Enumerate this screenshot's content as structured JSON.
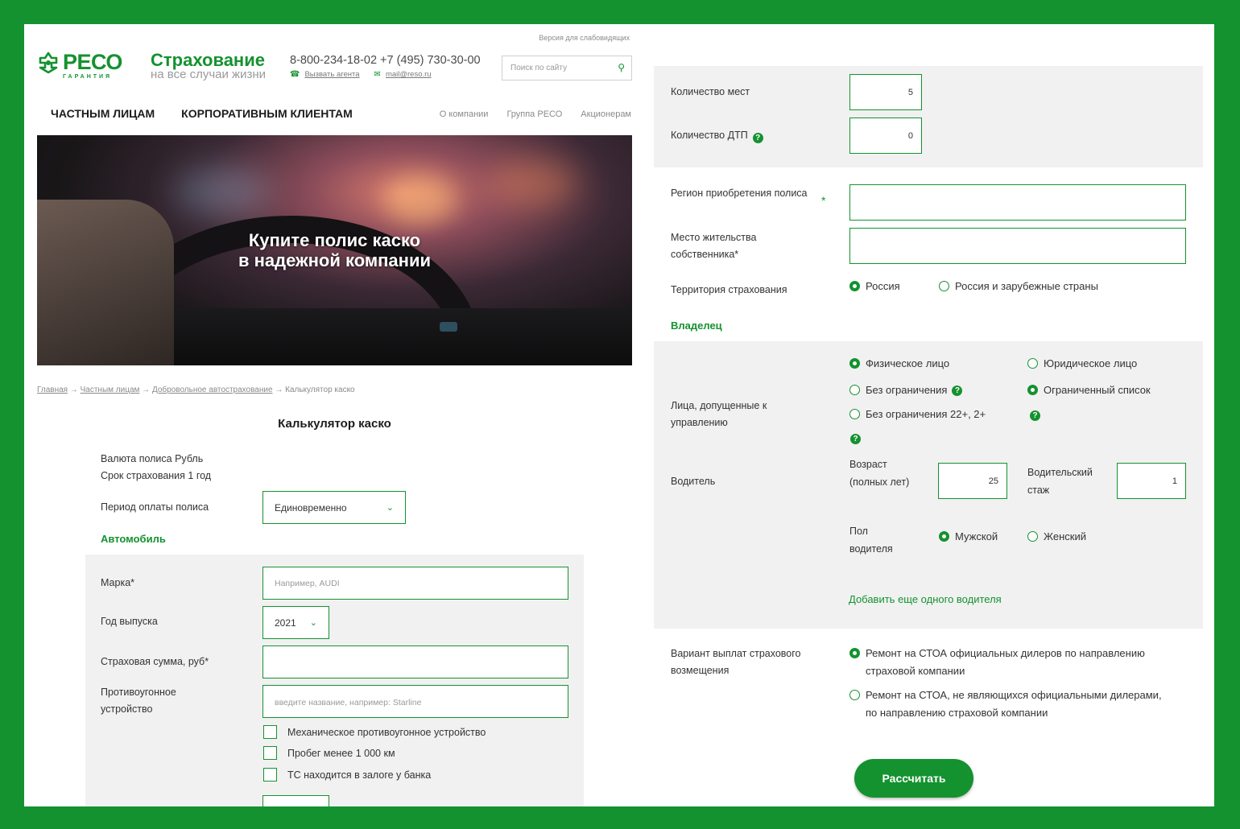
{
  "header": {
    "low_vision": "Версия для слабовидящих",
    "logo_name": "РЕСО",
    "logo_sub": "ГАРАНТИЯ",
    "brand_title": "Страхование",
    "brand_sub": "на все случаи жизни",
    "phones": "8-800-234-18-02 +7 (495) 730-30-00",
    "call_agent": "Вызвать агента",
    "email": "mail@reso.ru",
    "search_placeholder": "Поиск по сайту",
    "nav": [
      "ЧАСТНЫМ ЛИЦАМ",
      "КОРПОРАТИВНЫМ КЛИЕНТАМ"
    ],
    "nav_secondary": [
      "О компании",
      "Группа РЕСО",
      "Акционерам"
    ]
  },
  "hero": {
    "line1": "Купите полис каско",
    "line2": "в надежной компании"
  },
  "breadcrumb": {
    "items": [
      "Главная",
      "Частным лицам",
      "Добровольное автострахование",
      "Калькулятор каско"
    ],
    "sep": "→"
  },
  "calc": {
    "title": "Калькулятор каско",
    "currency": "Валюта полиса Рубль",
    "term": "Срок страхования 1 год",
    "period_label": "Период оплаты полиса",
    "period_value": "Единовременно",
    "car_section": "Автомобиль",
    "brand_label": "Марка*",
    "brand_placeholder": "Например, AUDI",
    "year_label": "Год выпуска",
    "year_value": "2021",
    "sum_label": "Страховая сумма, руб*",
    "sum_value": "",
    "antitheft_label": "Противоугонное устройство",
    "antitheft_placeholder": "введите название, например: Starline",
    "checkboxes": [
      "Механическое противоугонное устройство",
      "Пробег менее 1 000 км",
      "ТС находится в залоге у банка"
    ]
  },
  "right": {
    "seats_label": "Количество мест",
    "seats_value": "5",
    "accidents_label": "Количество ДТП",
    "accidents_value": "0",
    "region_label": "Регион приобретения полиса",
    "region_star": "*",
    "residence_label": "Место жительства собственника*",
    "territory_label": "Территория страхования",
    "territory_options": [
      "Россия",
      "Россия и зарубежные страны"
    ],
    "owner_section": "Владелец",
    "owner_options": [
      "Физическое лицо",
      "Юридическое лицо"
    ],
    "drivers_label": "Лица, допущенные к управлению",
    "drivers_options": [
      "Без ограничения",
      "Ограниченный список",
      "Без ограничения 22+, 2+"
    ],
    "driver_label": "Водитель",
    "age_label": "Возраст (полных лет)",
    "age_value": "25",
    "experience_label": "Водительский стаж",
    "experience_value": "1",
    "gender_label": "Пол водителя",
    "gender_options": [
      "Мужской",
      "Женский"
    ],
    "add_driver": "Добавить еще одного водителя",
    "payout_label": "Вариант выплат страхового возмещения",
    "payout_options": [
      "Ремонт на СТОА официальных дилеров по направлению страховой компании",
      "Ремонт на СТОА, не являющихся официальными дилерами, по направлению страховой компании"
    ],
    "calculate": "Рассчитать",
    "help": "?"
  }
}
